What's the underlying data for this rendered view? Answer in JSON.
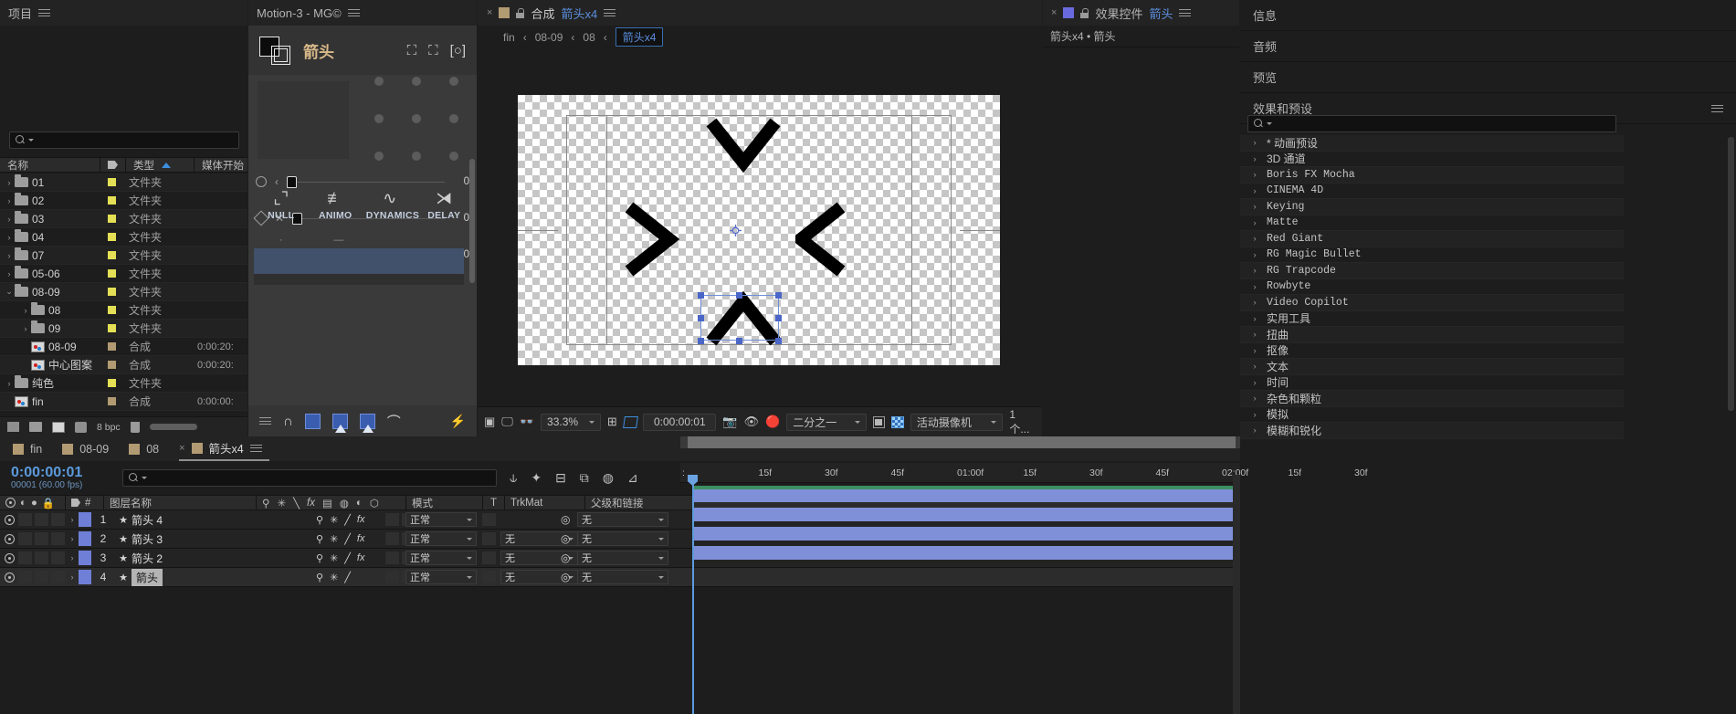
{
  "project": {
    "title": "项目",
    "search_placeholder": "",
    "columns": [
      "名称",
      "类型",
      "媒体开始"
    ],
    "tag_col_icon": "tag-icon",
    "rows": [
      {
        "indent": 0,
        "twirl": "›",
        "icon": "folder",
        "name": "01",
        "chip": "yellow",
        "type": "文件夹",
        "media": ""
      },
      {
        "indent": 0,
        "twirl": "›",
        "icon": "folder",
        "name": "02",
        "chip": "yellow",
        "type": "文件夹",
        "media": ""
      },
      {
        "indent": 0,
        "twirl": "›",
        "icon": "folder",
        "name": "03",
        "chip": "yellow",
        "type": "文件夹",
        "media": ""
      },
      {
        "indent": 0,
        "twirl": "›",
        "icon": "folder",
        "name": "04",
        "chip": "yellow",
        "type": "文件夹",
        "media": ""
      },
      {
        "indent": 0,
        "twirl": "›",
        "icon": "folder",
        "name": "07",
        "chip": "yellow",
        "type": "文件夹",
        "media": ""
      },
      {
        "indent": 0,
        "twirl": "›",
        "icon": "folder",
        "name": "05-06",
        "chip": "yellow",
        "type": "文件夹",
        "media": ""
      },
      {
        "indent": 0,
        "twirl": "⌄",
        "icon": "folder",
        "name": "08-09",
        "chip": "yellow",
        "type": "文件夹",
        "media": ""
      },
      {
        "indent": 1,
        "twirl": "›",
        "icon": "folder",
        "name": "08",
        "chip": "yellow",
        "type": "文件夹",
        "media": ""
      },
      {
        "indent": 1,
        "twirl": "›",
        "icon": "folder",
        "name": "09",
        "chip": "yellow",
        "type": "文件夹",
        "media": ""
      },
      {
        "indent": 1,
        "twirl": "",
        "icon": "comp",
        "name": "08-09",
        "chip": "tan",
        "type": "合成",
        "media": "0:00:20:"
      },
      {
        "indent": 1,
        "twirl": "",
        "icon": "comp",
        "name": "中心图案",
        "chip": "tan",
        "type": "合成",
        "media": "0:00:20:"
      },
      {
        "indent": 0,
        "twirl": "›",
        "icon": "folder",
        "name": "纯色",
        "chip": "yellow",
        "type": "文件夹",
        "media": ""
      },
      {
        "indent": 0,
        "twirl": "",
        "icon": "comp",
        "name": "fin",
        "chip": "tan",
        "type": "合成",
        "media": "0:00:00:"
      }
    ],
    "footer": {
      "bpc": "8 bpc"
    }
  },
  "motion": {
    "title": "Motion-3 - MG©",
    "layer_name": "箭头",
    "sliders": [
      {
        "shape": "circ",
        "arrow": "‹",
        "value": "0"
      },
      {
        "shape": "diam",
        "arrow": "✕",
        "value": "0"
      },
      {
        "shape": "sq",
        "arrow": "›",
        "value": "0"
      }
    ],
    "tools": [
      {
        "icon": "null-icon",
        "label": "NULL"
      },
      {
        "icon": "animo-icon",
        "label": "ANIMO"
      },
      {
        "icon": "dynamics-icon",
        "label": "DYNAMICS"
      },
      {
        "icon": "delay-icon",
        "label": "DELAY"
      }
    ]
  },
  "composition": {
    "tab_label": "合成",
    "tab_name": "箭头x4",
    "breadcrumbs": [
      "fin",
      "08-09",
      "08"
    ],
    "breadcrumb_active": "箭头x4",
    "toolbar": {
      "zoom": "33.3%",
      "time": "0:00:00:01",
      "resolution": "二分之一",
      "view": "活动摄像机",
      "views_count": "1 个..."
    }
  },
  "effect_controls": {
    "title": "效果控件",
    "title_target": "箭头",
    "subtitle": "箭头x4 • 箭头"
  },
  "rail": {
    "sections": [
      "信息",
      "音频",
      "预览"
    ],
    "effects_title": "效果和预设",
    "effects_search_placeholder": "",
    "effects": [
      "* 动画预设",
      "3D 通道",
      "Boris FX Mocha",
      "CINEMA 4D",
      "Keying",
      "Matte",
      "Red Giant",
      "RG Magic Bullet",
      "RG Trapcode",
      "Rowbyte",
      "Video Copilot",
      "实用工具",
      "扭曲",
      "抠像",
      "文本",
      "时间",
      "杂色和颗粒",
      "模拟",
      "模糊和锐化"
    ]
  },
  "timeline": {
    "tabs": [
      {
        "label": "fin",
        "active": false
      },
      {
        "label": "08-09",
        "active": false
      },
      {
        "label": "08",
        "active": false
      },
      {
        "label": "箭头x4",
        "active": true
      }
    ],
    "current_time": "0:00:00:01",
    "frame_info": "00001 (60.00 fps)",
    "search_placeholder": "",
    "columns": [
      "#",
      "图层名称",
      "模式",
      "T",
      "TrkMat",
      "父级和链接"
    ],
    "layers": [
      {
        "num": "1",
        "name": "箭头 4",
        "mode": "正常",
        "trkmat": "",
        "parent": "无",
        "editing": false,
        "fx": true
      },
      {
        "num": "2",
        "name": "箭头 3",
        "mode": "正常",
        "trkmat": "无",
        "parent": "无",
        "editing": false,
        "fx": true
      },
      {
        "num": "3",
        "name": "箭头 2",
        "mode": "正常",
        "trkmat": "无",
        "parent": "无",
        "editing": false,
        "fx": true
      },
      {
        "num": "4",
        "name": "箭头",
        "mode": "正常",
        "trkmat": "无",
        "parent": "无",
        "editing": true,
        "fx": false
      }
    ],
    "ruler_ticks": [
      "15f",
      "30f",
      "45f",
      "01:00f",
      "15f",
      "30f",
      "45f",
      "02:00f",
      "15f",
      "30f"
    ]
  },
  "colors": {
    "accent_blue": "#5b8ede",
    "layer_blue": "#6f7fd8",
    "folder_yellow": "#e4df55",
    "comp_tan": "#b29a72",
    "motion_title": "#d9b98a"
  }
}
